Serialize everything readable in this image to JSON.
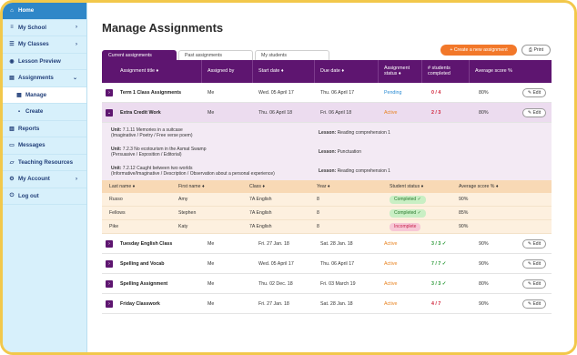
{
  "sidebar": {
    "items": [
      {
        "label": "Home",
        "icon": "home-icon",
        "glyph": "⌂",
        "chev": ""
      },
      {
        "label": "My School",
        "icon": "list-icon",
        "glyph": "≡",
        "chev": "›"
      },
      {
        "label": "My Classes",
        "icon": "classes-icon",
        "glyph": "☰",
        "chev": "›"
      },
      {
        "label": "Lesson Preview",
        "icon": "preview-icon",
        "glyph": "◉",
        "chev": ""
      },
      {
        "label": "Assignments",
        "icon": "assignments-icon",
        "glyph": "▤",
        "chev": "⌄"
      },
      {
        "label": "Manage",
        "icon": "manage-icon",
        "glyph": "▦",
        "chev": ""
      },
      {
        "label": "Create",
        "icon": "create-icon",
        "glyph": "▪",
        "chev": ""
      },
      {
        "label": "Reports",
        "icon": "reports-icon",
        "glyph": "▥",
        "chev": ""
      },
      {
        "label": "Messages",
        "icon": "messages-icon",
        "glyph": "▭",
        "chev": ""
      },
      {
        "label": "Teaching Resources",
        "icon": "resources-icon",
        "glyph": "▱",
        "chev": ""
      },
      {
        "label": "My Account",
        "icon": "account-icon",
        "glyph": "⚙",
        "chev": "›"
      },
      {
        "label": "Log out",
        "icon": "logout-icon",
        "glyph": "⏻",
        "chev": ""
      }
    ]
  },
  "page": {
    "title": "Manage Assignments"
  },
  "tabs": [
    "Current assignments",
    "Past assignments",
    "My students"
  ],
  "buttons": {
    "create": "+ Create a new assignment",
    "print": "⎙ Print",
    "edit": "✎ Edit"
  },
  "table": {
    "headers": [
      "Assignment title ♦",
      "Assigned by",
      "Start date ♦",
      "Due date ♦",
      "Assignment status ♦",
      "# students completed",
      "Average score %"
    ],
    "rows": [
      {
        "title": "Term 1 Class Assignments",
        "by": "Me",
        "start": "Wed. 05 April 17",
        "due": "Thu. 06 April 17",
        "status": "Pending",
        "count": "0 / 4",
        "avg": "80%"
      },
      {
        "title": "Extra Credit Work",
        "by": "Me",
        "start": "Thu. 06 April 18",
        "due": "Fri. 06 April 18",
        "status": "Active",
        "count": "2 / 3",
        "avg": "80%"
      }
    ],
    "units": [
      {
        "unit": "7.1.11",
        "name": "Memories in a suitcase",
        "tags": "(Imaginative / Poetry / Free verse poem)",
        "lesson": "Reading comprehension 1"
      },
      {
        "unit": "7.2.3",
        "name": "No ecotourism in the Asmat Swamp",
        "tags": "(Persuasive / Exposition / Editorial)",
        "lesson": "Punctuation"
      },
      {
        "unit": "7.2.12",
        "name": "Caught between two worlds",
        "tags": "(Informative/Imaginative / Description / Observation about a personal experience)",
        "lesson": "Reading comprehension 1"
      }
    ],
    "unit_label": "Unit:",
    "lesson_label": "Lesson:",
    "student_headers": [
      "Last name ♦",
      "First name ♦",
      "Class ♦",
      "Year ♦",
      "Student status ♦",
      "Average score % ♦"
    ],
    "students": [
      {
        "last": "Russo",
        "first": "Amy",
        "class": "7A English",
        "year": "8",
        "status": "Completed ✓",
        "avg": "90%"
      },
      {
        "last": "Fellows",
        "first": "Stephen",
        "class": "7A English",
        "year": "8",
        "status": "Completed ✓",
        "avg": "85%"
      },
      {
        "last": "Pike",
        "first": "Katy",
        "class": "7A English",
        "year": "8",
        "status": "Incomplete",
        "avg": "90%"
      }
    ],
    "more_rows": [
      {
        "title": "Tuesday English Class",
        "by": "Me",
        "start": "Fri. 27 Jan. 18",
        "due": "Sat. 28 Jan. 18",
        "status": "Active",
        "count": "3 / 3 ✓",
        "avg": "90%"
      },
      {
        "title": "Spelling and Vocab",
        "by": "Me",
        "start": "Wed. 05 April 17",
        "due": "Thu. 06 April 17",
        "status": "Active",
        "count": "7 / 7 ✓",
        "avg": "90%"
      },
      {
        "title": "Spelling Assignment",
        "by": "Me",
        "start": "Thu. 02 Dec. 18",
        "due": "Fri. 03 March 19",
        "status": "Active",
        "count": "3 / 3 ✓",
        "avg": "80%"
      },
      {
        "title": "Friday Classwork",
        "by": "Me",
        "start": "Fri. 27 Jan. 18",
        "due": "Sat. 28 Jan. 18",
        "status": "Active",
        "count": "4 / 7",
        "avg": "90%"
      }
    ]
  }
}
